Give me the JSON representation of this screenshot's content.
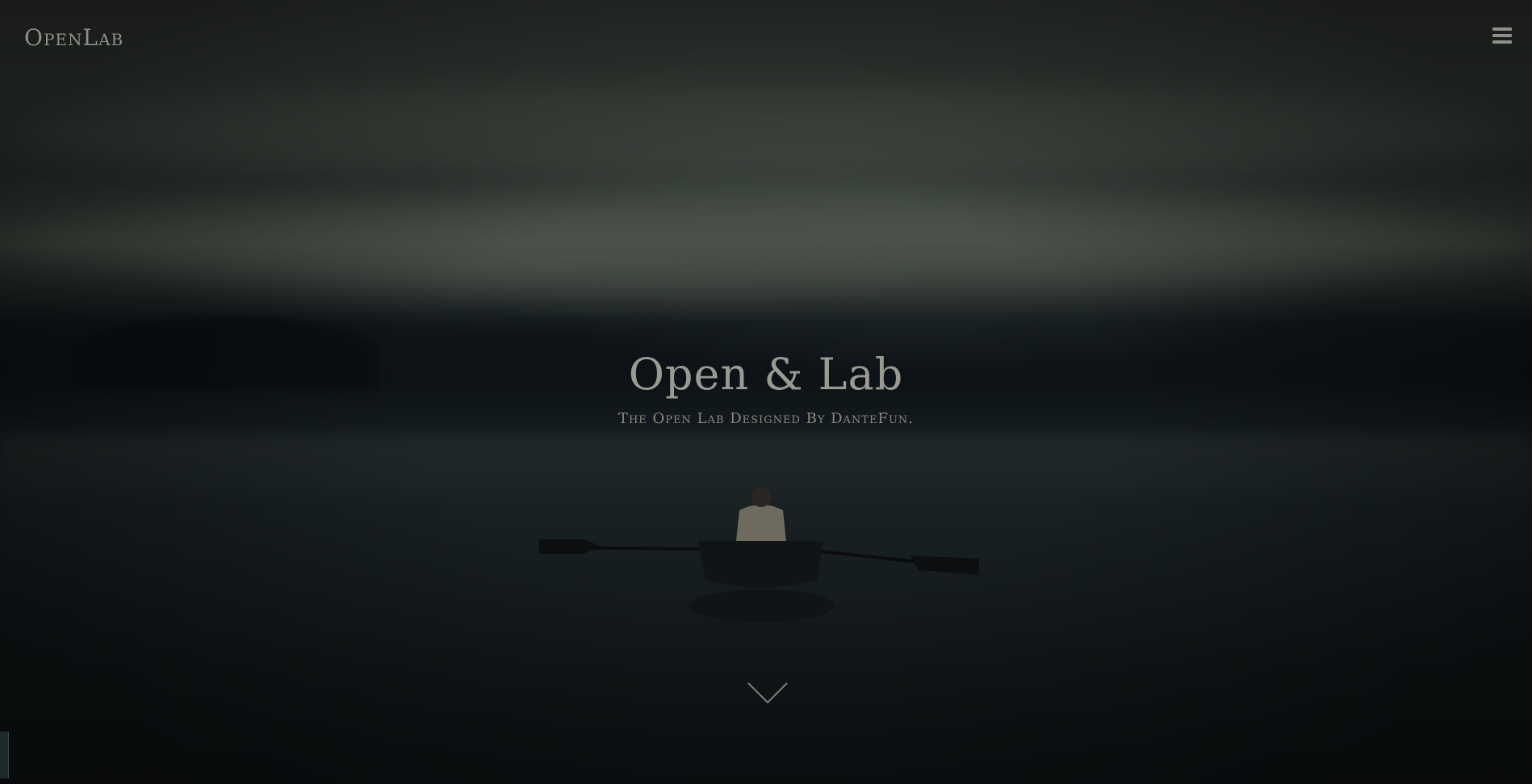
{
  "header": {
    "logo_text": "OpenLab",
    "menu_icon": "hamburger-menu-icon"
  },
  "hero": {
    "title": "Open & Lab",
    "subtitle": "The Open Lab Designed By DanteFun.",
    "scroll_icon": "chevron-down-icon",
    "background": "misty-lake-rowboat-photo"
  },
  "colors": {
    "text_primary": "#9a9a92",
    "text_secondary": "#8a8880",
    "overlay": "#0b0e10"
  }
}
